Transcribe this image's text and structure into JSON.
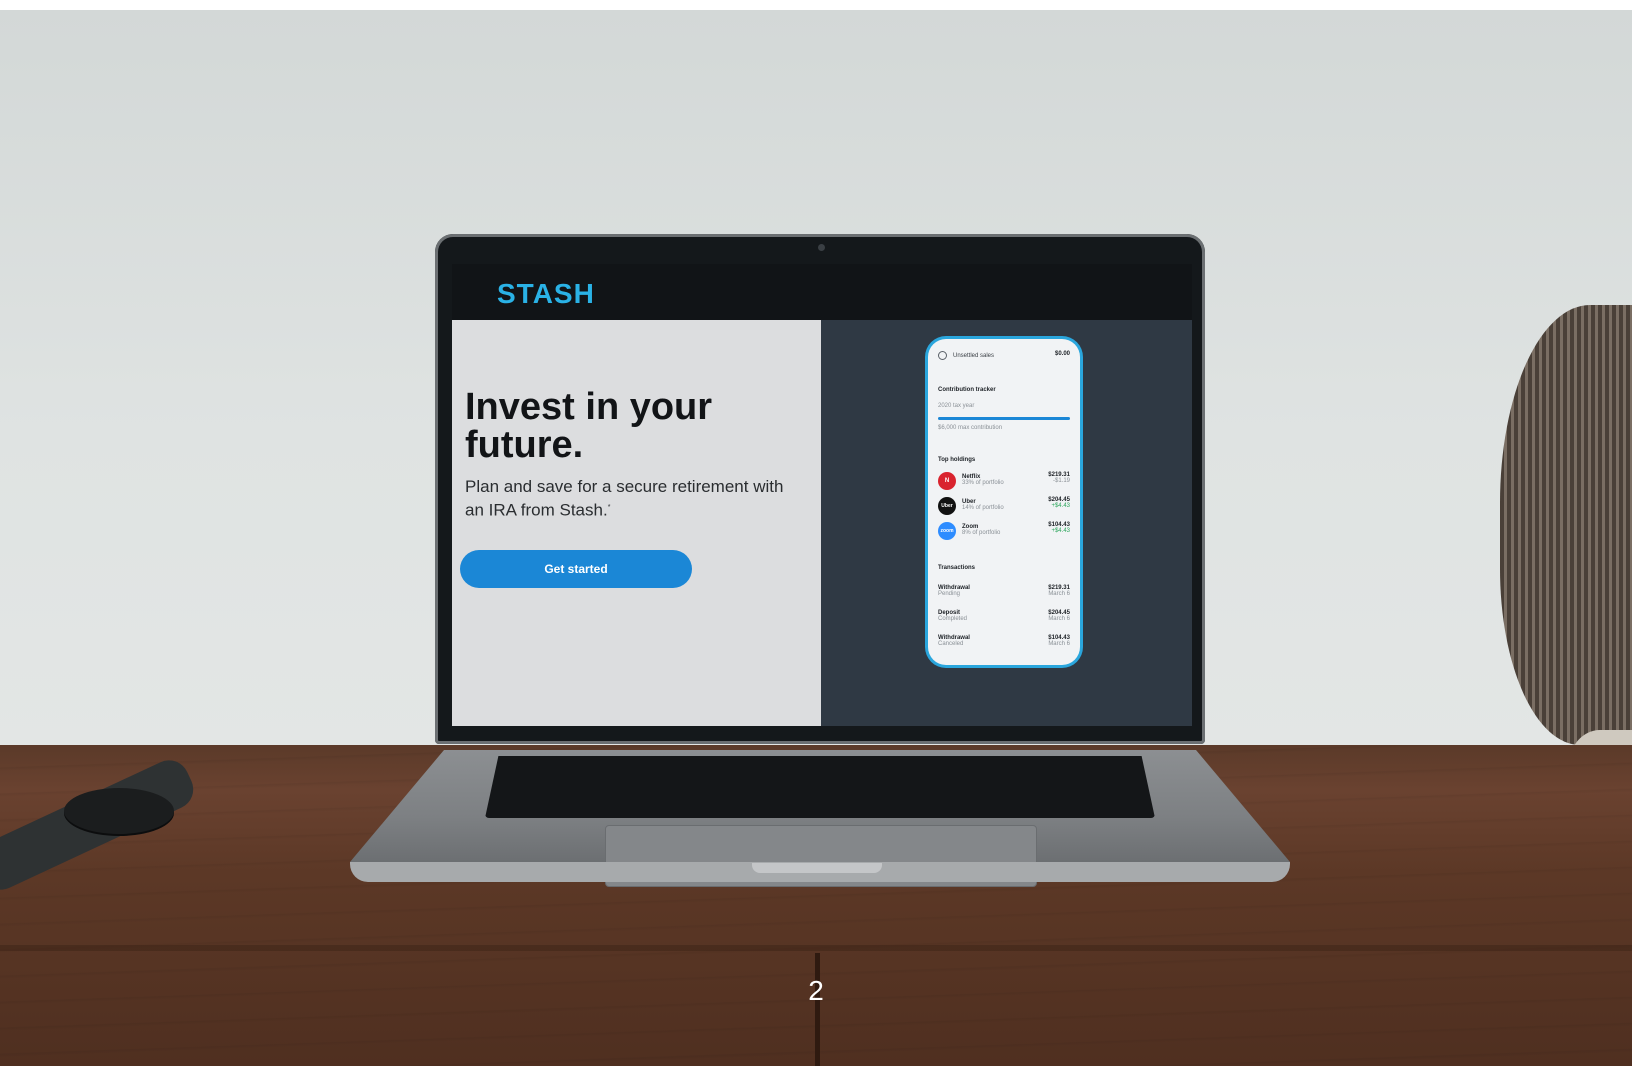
{
  "site": {
    "logo": "STASH",
    "hero_title": "Invest in your future.",
    "hero_subtitle": "Plan and save for a secure retirement with an IRA from Stash.",
    "cta_label": "Get started"
  },
  "phone": {
    "top_label": "Unsettled sales",
    "top_value": "$0.00",
    "tracker_title": "Contribution tracker",
    "tracker_year": "2020 tax year",
    "tracker_max": "$6,000 max contribution",
    "holdings_title": "Top holdings",
    "holdings": [
      {
        "icon": "N",
        "name": "Netflix",
        "share": "33% of portfolio",
        "value": "$219.31",
        "change": "-$1.19"
      },
      {
        "icon": "Uber",
        "name": "Uber",
        "share": "14% of portfolio",
        "value": "$204.45",
        "change": "+$4.43"
      },
      {
        "icon": "zoom",
        "name": "Zoom",
        "share": "8% of portfolio",
        "value": "$104.43",
        "change": "+$4.43"
      }
    ],
    "transactions_title": "Transactions",
    "transactions": [
      {
        "type": "Withdrawal",
        "status": "Pending",
        "amount": "$219.31",
        "date": "March 6"
      },
      {
        "type": "Deposit",
        "status": "Completed",
        "amount": "$204.45",
        "date": "March 6"
      },
      {
        "type": "Withdrawal",
        "status": "Canceled",
        "amount": "$104.43",
        "date": "March 6"
      }
    ]
  },
  "colors": {
    "brand": "#2ab2e6",
    "cta": "#1b87d6",
    "netflix": "#d9232e",
    "uber": "#111111",
    "zoom": "#2d8cff"
  },
  "page_number": "2"
}
